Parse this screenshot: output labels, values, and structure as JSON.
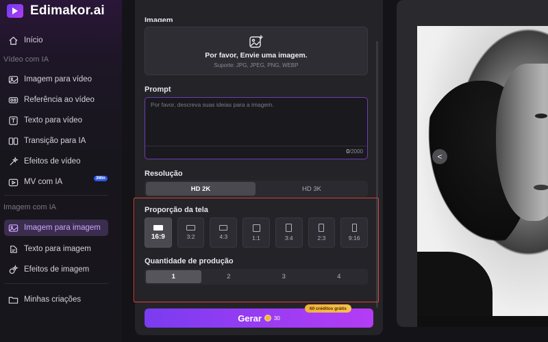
{
  "app": {
    "brand_name": "Edimakor.ai"
  },
  "sidebar": {
    "home": "Início",
    "section_video": "Vídeo com IA",
    "video_items": [
      {
        "label": "Imagem para vídeo",
        "icon": "image-video-icon"
      },
      {
        "label": "Referência ao vídeo",
        "icon": "reference-video-icon"
      },
      {
        "label": "Texto para vídeo",
        "icon": "text-video-icon"
      },
      {
        "label": "Transição para IA",
        "icon": "transition-icon"
      },
      {
        "label": "Efeitos de vídeo",
        "icon": "effects-icon"
      },
      {
        "label": "MV com IA",
        "icon": "mv-icon",
        "badge": "3Min"
      }
    ],
    "section_image": "Imagem com IA",
    "image_items": [
      {
        "label": "Imagem para imagem",
        "icon": "image-image-icon",
        "active": true
      },
      {
        "label": "Texto para imagem",
        "icon": "text-image-icon"
      },
      {
        "label": "Efeitos de imagem",
        "icon": "image-effects-icon"
      }
    ],
    "my_creations": "Minhas criações"
  },
  "form": {
    "image_label": "Imagem",
    "upload_title": "Por favor, Envie uma imagem.",
    "upload_support": "Suporte: JPG, JPEG, PNG, WEBP",
    "prompt_label": "Prompt",
    "prompt_placeholder": "Por favor, descreva suas ideias para a imagem.",
    "prompt_count": "0",
    "prompt_max": "/2000",
    "resolution_label": "Resolução",
    "resolutions": [
      "HD 2K",
      "HD 3K"
    ],
    "resolution_selected": "HD 2K",
    "ratio_label": "Proporção da tela",
    "ratios": [
      "16:9",
      "3:2",
      "4:3",
      "1:1",
      "3:4",
      "2:3",
      "9:16"
    ],
    "ratio_selected": "16:9",
    "quantity_label": "Quantidade de produção",
    "quantities": [
      "1",
      "2",
      "3",
      "4"
    ],
    "quantity_selected": "1",
    "generate_label": "Gerar",
    "generate_cost": "30",
    "free_credits": "60 créditos grátis"
  },
  "preview": {
    "prev_symbol": "<"
  },
  "colors": {
    "accent": "#7a3cf0",
    "highlight": "#d9463a",
    "credit": "#f0b03a"
  }
}
